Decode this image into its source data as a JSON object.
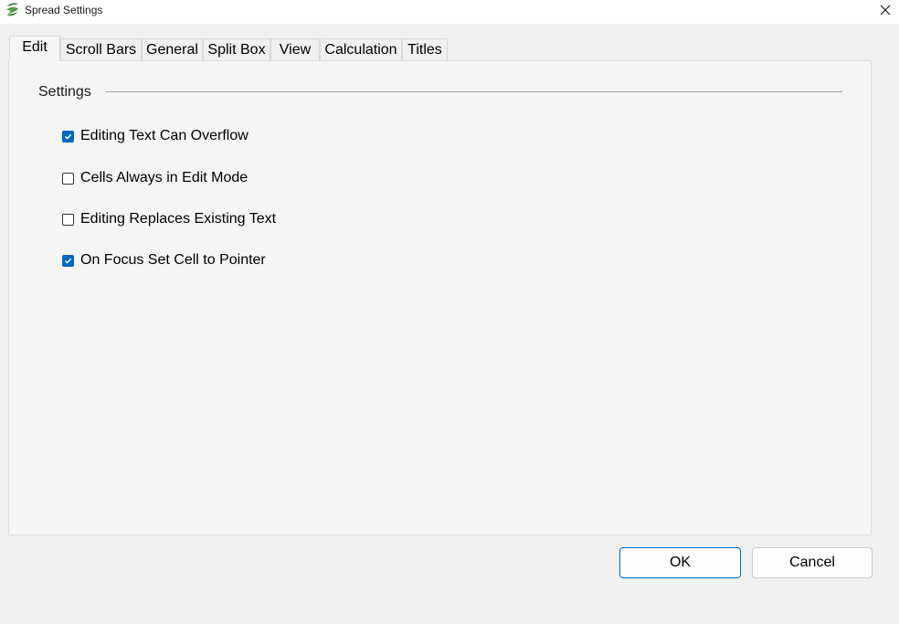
{
  "window": {
    "title": "Spread Settings",
    "icon": "spread-logo-icon",
    "close_icon": "close-icon"
  },
  "tabs": [
    {
      "label": "Edit",
      "active": true
    },
    {
      "label": "Scroll Bars",
      "active": false
    },
    {
      "label": "General",
      "active": false
    },
    {
      "label": "Split Box",
      "active": false
    },
    {
      "label": "View",
      "active": false
    },
    {
      "label": "Calculation",
      "active": false
    },
    {
      "label": "Titles",
      "active": false
    }
  ],
  "settings": {
    "group_label": "Settings",
    "options": [
      {
        "label": "Editing Text Can Overflow",
        "checked": true
      },
      {
        "label": "Cells Always in Edit Mode",
        "checked": false
      },
      {
        "label": "Editing Replaces Existing Text",
        "checked": false
      },
      {
        "label": "On Focus Set Cell to Pointer",
        "checked": true
      }
    ]
  },
  "buttons": {
    "ok": "OK",
    "cancel": "Cancel"
  },
  "colors": {
    "accent": "#0067c0",
    "logo": "#3f7d3a"
  }
}
